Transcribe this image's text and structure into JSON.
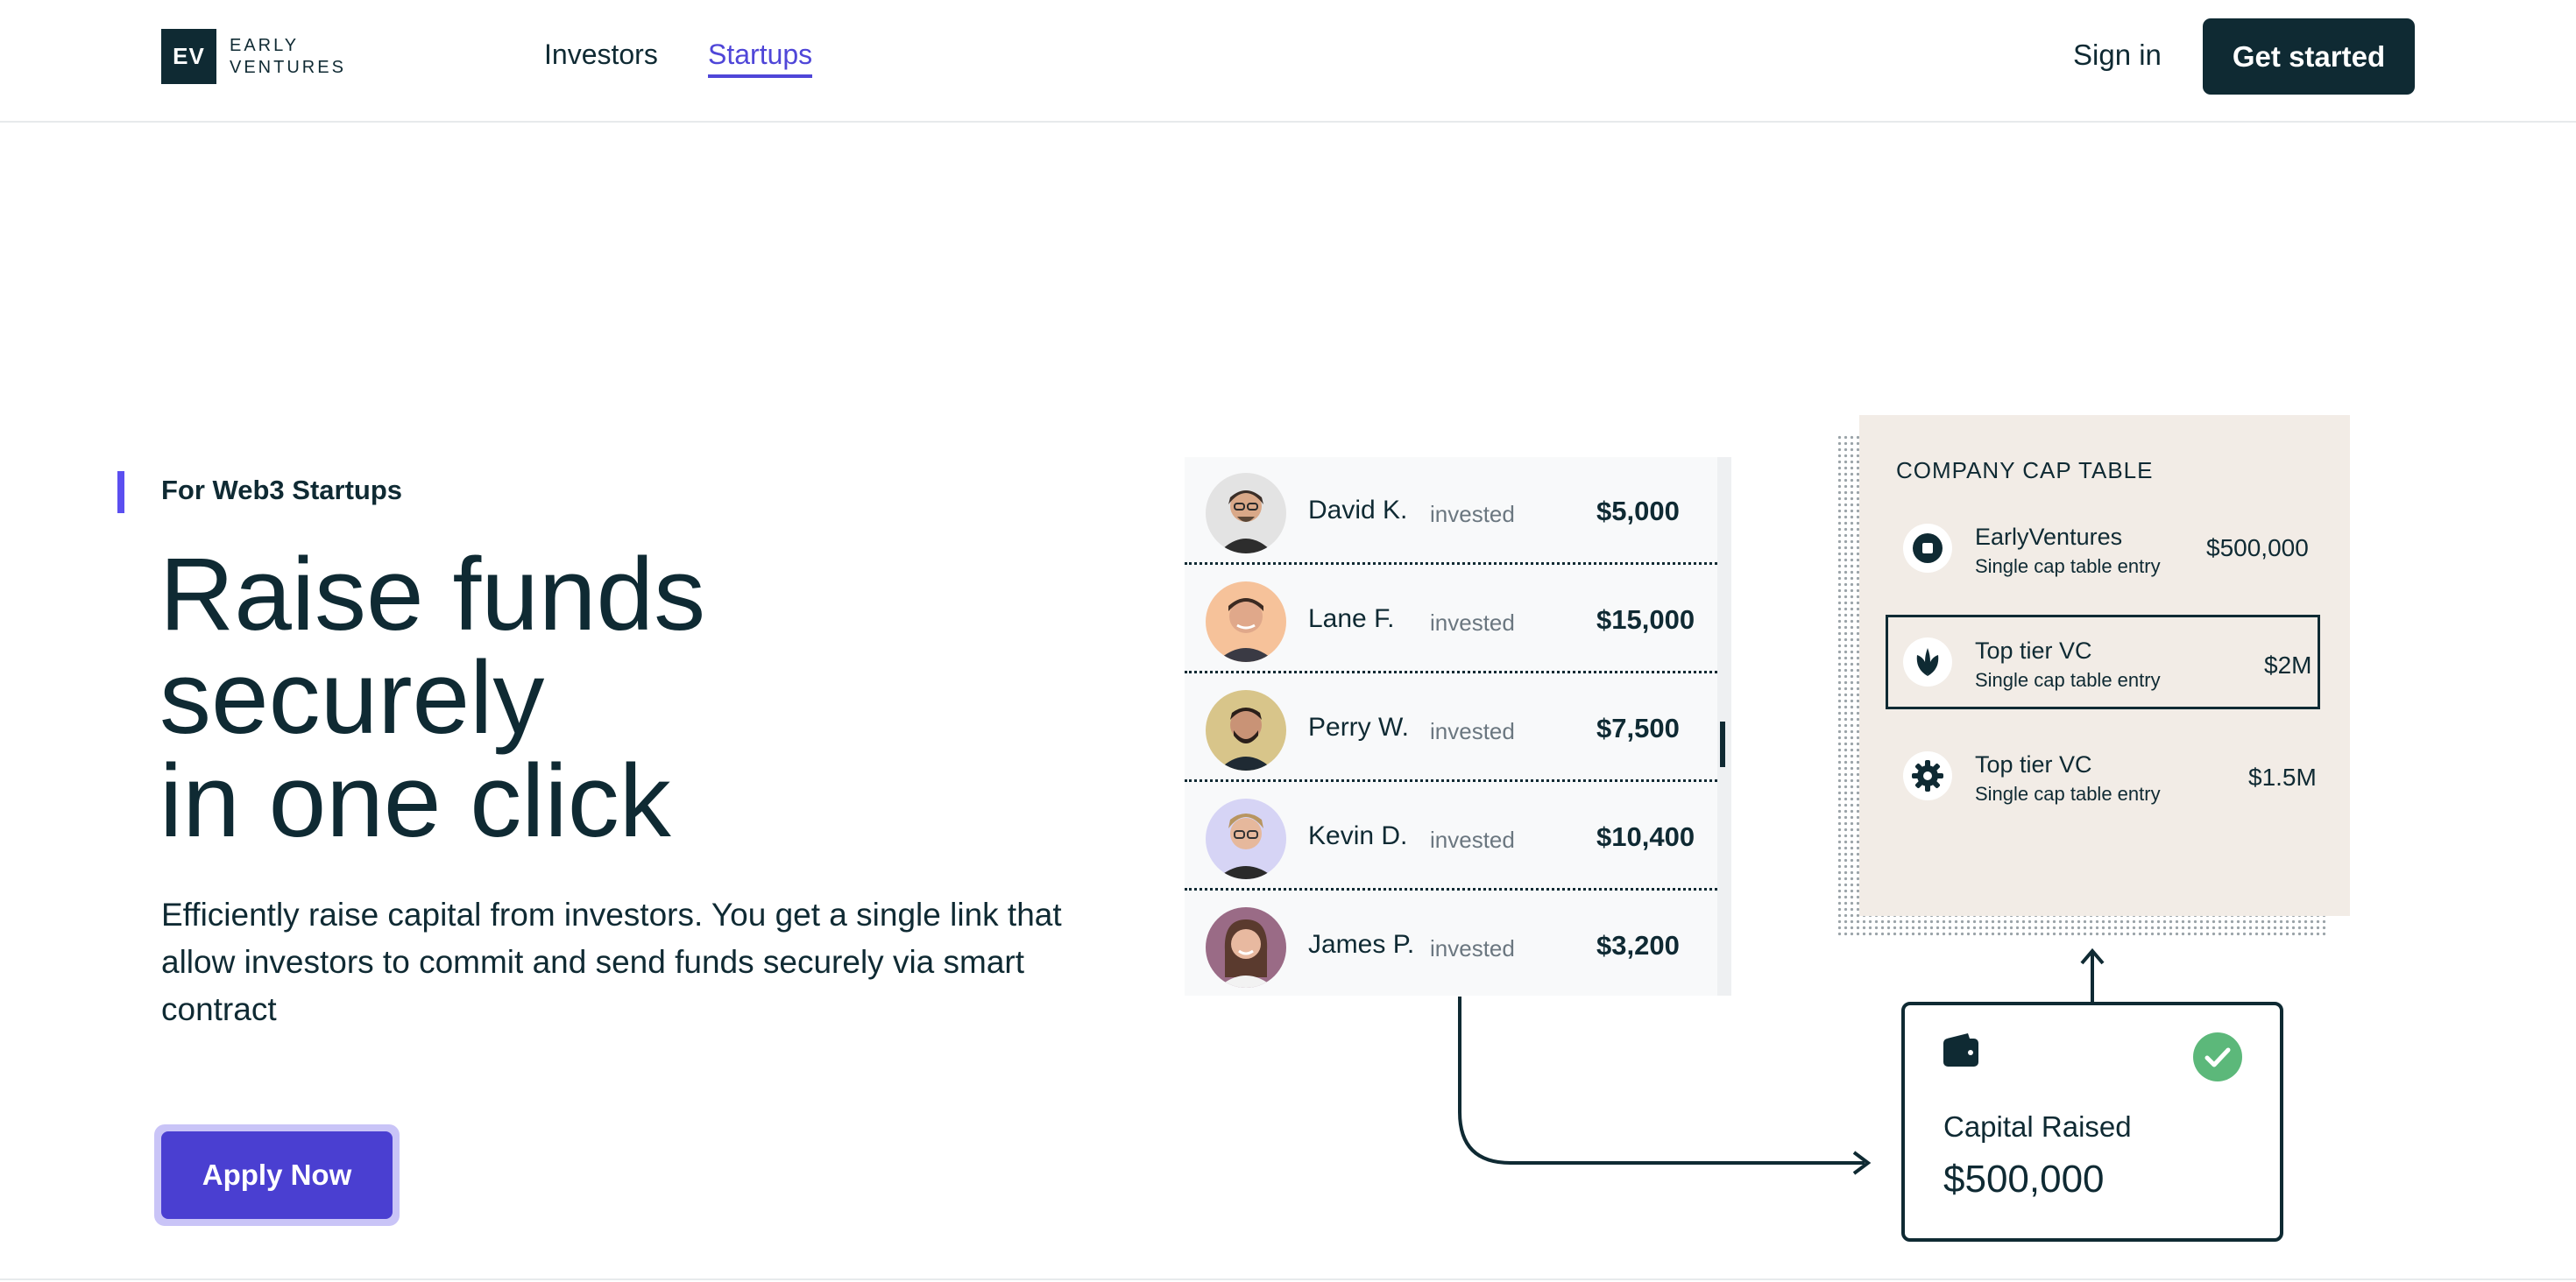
{
  "header": {
    "logo_mark": "EV",
    "logo_line1": "EARLY",
    "logo_line2": "VENTURES",
    "nav": [
      {
        "label": "Investors",
        "active": false
      },
      {
        "label": "Startups",
        "active": true
      }
    ],
    "sign_in": "Sign in",
    "get_started": "Get started"
  },
  "hero": {
    "eyebrow": "For Web3 Startups",
    "headline_line1": "Raise funds",
    "headline_line2": "securely",
    "headline_line3": "in one click",
    "description": "Efficiently raise capital from investors. You get a single link that allow investors to commit and send funds securely via smart contract",
    "cta": "Apply Now"
  },
  "investors": {
    "invested_word": "invested",
    "rows": [
      {
        "name": "David K.",
        "amount": "$5,000"
      },
      {
        "name": "Lane F.",
        "amount": "$15,000"
      },
      {
        "name": "Perry W.",
        "amount": "$7,500"
      },
      {
        "name": "Kevin D.",
        "amount": "$10,400"
      },
      {
        "name": "James P.",
        "amount": "$3,200"
      }
    ]
  },
  "cap_table": {
    "title": "COMPANY CAP TABLE",
    "entries": [
      {
        "name": "EarlyVentures",
        "sub": "Single cap table entry",
        "amount": "$500,000",
        "icon": "stop-circle-icon"
      },
      {
        "name": "Top tier VC",
        "sub": "Single cap table entry",
        "amount": "$2M",
        "icon": "leaf-icon"
      },
      {
        "name": "Top tier VC",
        "sub": "Single cap table entry",
        "amount": "$1.5M",
        "icon": "gear-icon"
      }
    ]
  },
  "raised": {
    "label": "Capital Raised",
    "amount": "$500,000"
  },
  "colors": {
    "brand_dark": "#0f2a33",
    "accent": "#4a3fd1",
    "cap_bg": "#f2ece6",
    "success": "#5cb87a"
  }
}
